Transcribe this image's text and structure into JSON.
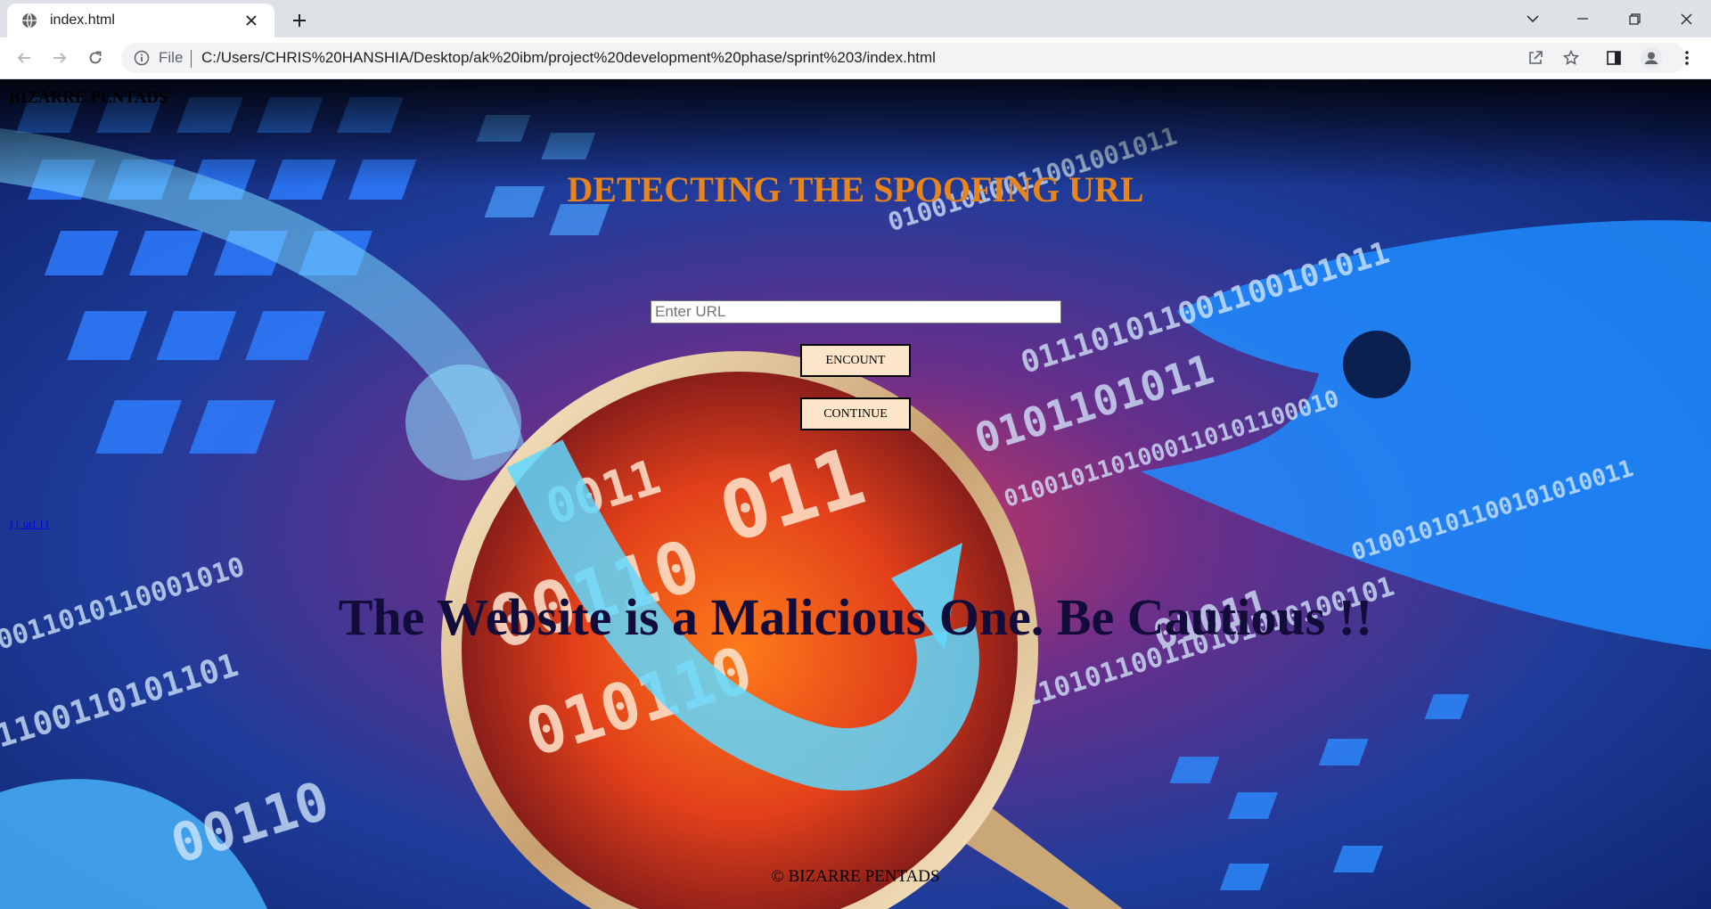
{
  "browser": {
    "tab_title": "index.html",
    "address_scheme_label": "File",
    "address_url": "C:/Users/CHRIS%20HANSHIA/Desktop/ak%20ibm/project%20development%20phase/sprint%203/index.html"
  },
  "page": {
    "brand": "BIZARRE PENTADS",
    "heading": "DETECTING THE SPOOFING URL",
    "url_input": {
      "placeholder": "Enter URL",
      "value": ""
    },
    "encount_button": "ENCOUNT",
    "continue_button": "CONTINUE",
    "url_link": "{{ url }}",
    "result_message": "The Website is a Malicious One. Be Cautious !!",
    "footer": "© BIZARRE PENTADS"
  },
  "colors": {
    "heading": "#e8841c",
    "result": "#120c3a",
    "button_bg": "#fde5c9",
    "link": "#0000ee"
  },
  "icons": {
    "tab": "globe-icon",
    "tab_close": "close-icon",
    "new_tab": "plus-icon",
    "back": "back-arrow-icon",
    "forward": "forward-arrow-icon",
    "reload": "reload-icon",
    "site_info": "info-icon",
    "share": "share-icon",
    "bookmark": "star-icon",
    "side_panel": "side-panel-icon",
    "profile": "profile-icon",
    "menu": "kebab-menu-icon"
  }
}
